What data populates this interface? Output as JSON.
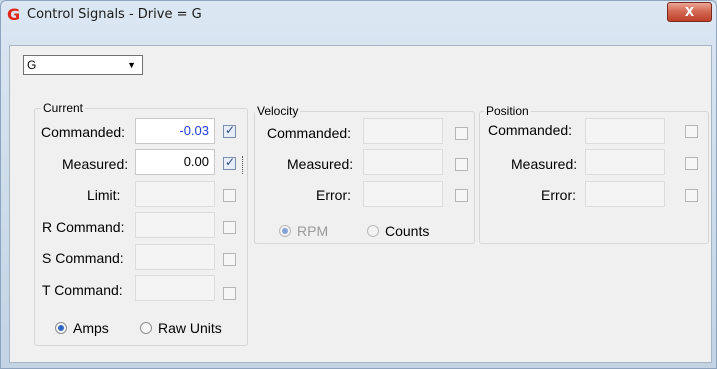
{
  "window": {
    "title": "Control Signals - Drive = G",
    "close_glyph": "X"
  },
  "drive_select": {
    "value": "G"
  },
  "current": {
    "title": "Current",
    "rows": [
      {
        "label": "Commanded:",
        "value": "-0.03",
        "checked": true
      },
      {
        "label": "Measured:",
        "value": "0.00",
        "checked": true
      },
      {
        "label": "Limit:",
        "value": "",
        "checked": false
      },
      {
        "label": "R Command:",
        "value": "",
        "checked": false
      },
      {
        "label": "S Command:",
        "value": "",
        "checked": false
      },
      {
        "label": "T Command:",
        "value": "",
        "checked": false
      }
    ],
    "units": [
      {
        "label": "Amps",
        "selected": true
      },
      {
        "label": "Raw Units",
        "selected": false
      }
    ]
  },
  "velocity": {
    "title": "Velocity",
    "rows": [
      {
        "label": "Commanded:",
        "value": "",
        "checked": false
      },
      {
        "label": "Measured:",
        "value": "",
        "checked": false
      },
      {
        "label": "Error:",
        "value": "",
        "checked": false
      }
    ],
    "units": [
      {
        "label": "RPM",
        "selected": true
      },
      {
        "label": "Counts",
        "selected": false
      }
    ]
  },
  "position": {
    "title": "Position",
    "rows": [
      {
        "label": "Commanded:",
        "value": "",
        "checked": false
      },
      {
        "label": "Measured:",
        "value": "",
        "checked": false
      },
      {
        "label": "Error:",
        "value": "",
        "checked": false
      }
    ]
  }
}
